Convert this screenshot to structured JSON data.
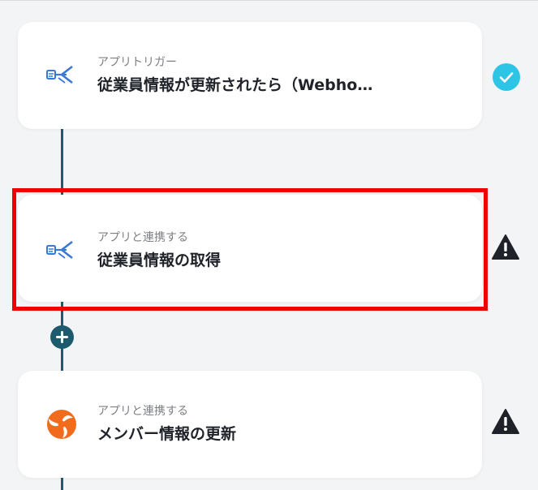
{
  "flow": {
    "steps": [
      {
        "type_label": "アプリトリガー",
        "title": "従業員情報が更新されたら（Webho…",
        "app_icon": "smarthr-logo-icon",
        "status": "completed",
        "status_icon": "check-circle-icon",
        "highlighted": false
      },
      {
        "type_label": "アプリと連携する",
        "title": "従業員情報の取得",
        "app_icon": "smarthr-logo-icon",
        "status": "warning",
        "status_icon": "warning-triangle-icon",
        "highlighted": true
      },
      {
        "type_label": "アプリと連携する",
        "title": "メンバー情報の更新",
        "app_icon": "orange-swirl-app-icon",
        "status": "warning",
        "status_icon": "warning-triangle-icon",
        "highlighted": false
      }
    ],
    "add_step_icon": "plus-icon"
  },
  "colors": {
    "connector": "#1e5a6e",
    "check": "#2ec4e6",
    "warning": "#1f2329",
    "highlight": "#ee0000",
    "app_blue": "#3a78d6",
    "app_orange": "#f26a1b"
  }
}
